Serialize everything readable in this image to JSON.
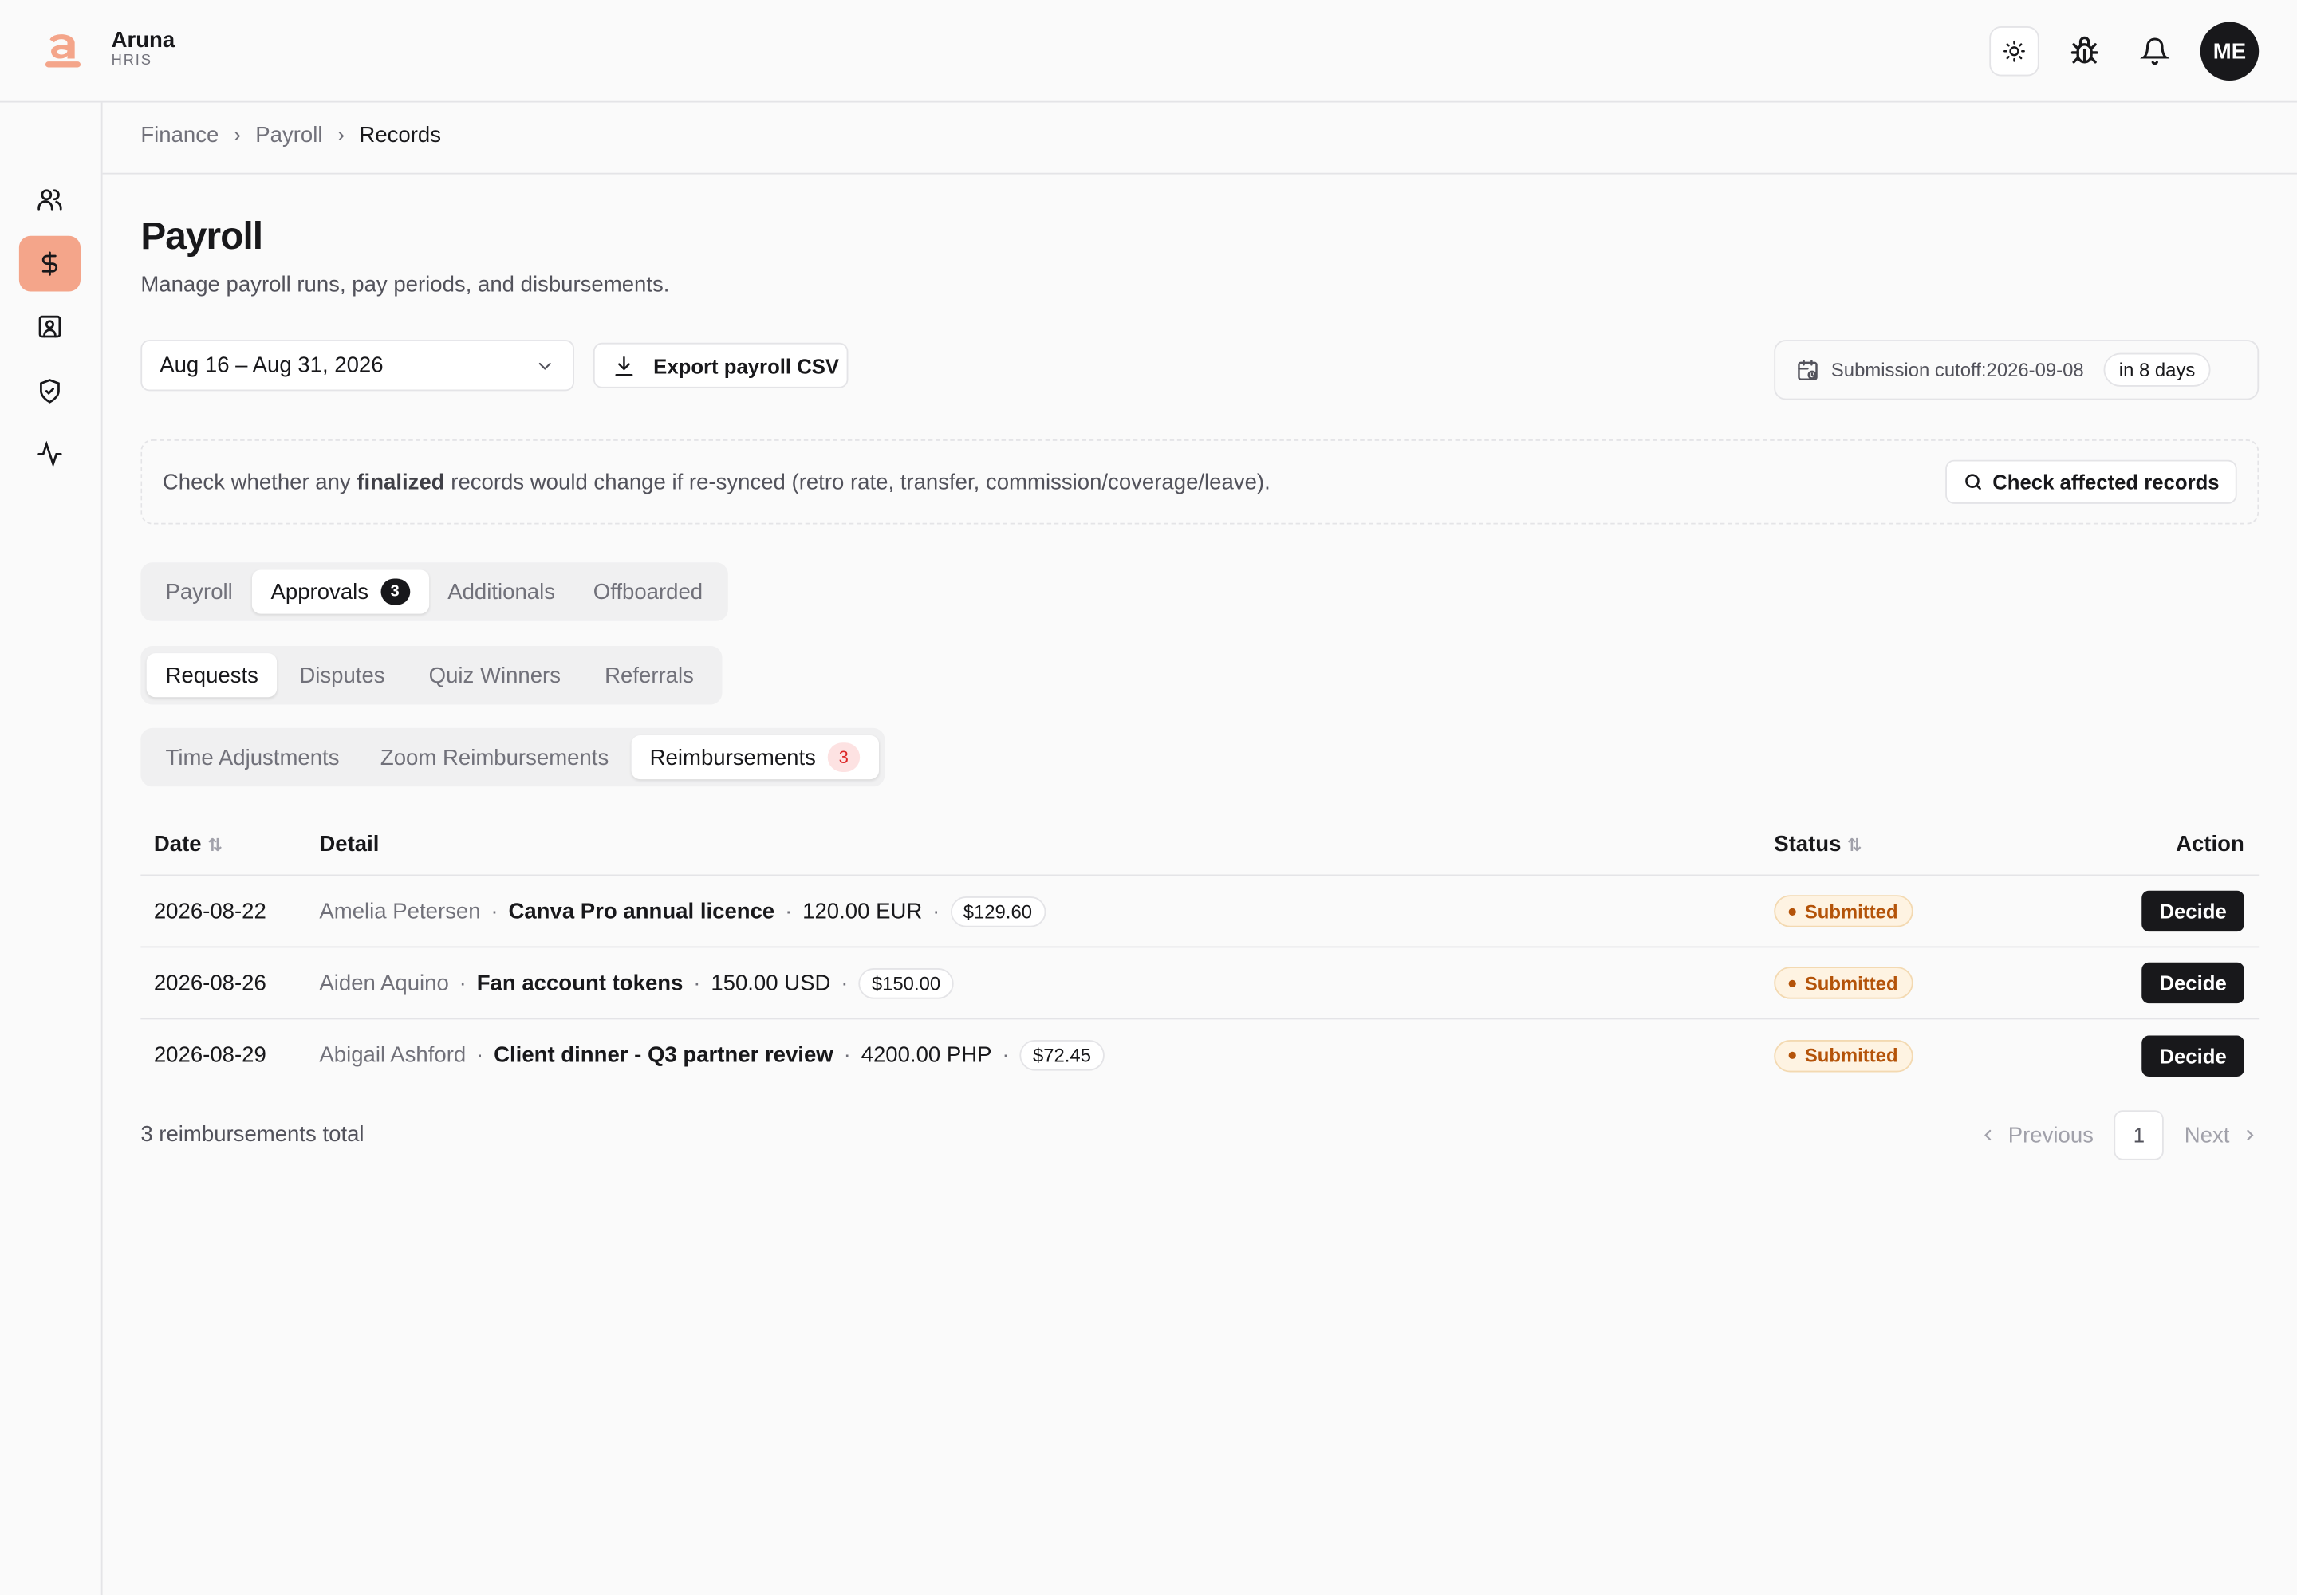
{
  "brand": {
    "name": "Aruna",
    "sub": "HRIS"
  },
  "user": {
    "initials": "ME"
  },
  "breadcrumb": [
    "Finance",
    "Payroll",
    "Records"
  ],
  "page": {
    "title": "Payroll",
    "subtitle": "Manage payroll runs, pay periods, and disbursements."
  },
  "controls": {
    "period": "Aug 16 – Aug 31, 2026",
    "export_label": "Export payroll CSV",
    "cutoff_label": "Submission cutoff:",
    "cutoff_date": "2026-09-08",
    "cutoff_remaining": "in 8 days"
  },
  "banner": {
    "text_before": "Check whether any ",
    "text_bold": "finalized",
    "text_after": " records would change if re-synced (retro rate, transfer, commission/coverage/leave).",
    "button_label": "Check affected records"
  },
  "main_tabs": [
    {
      "label": "Payroll"
    },
    {
      "label": "Approvals",
      "count": "3"
    },
    {
      "label": "Additionals"
    },
    {
      "label": "Offboarded"
    }
  ],
  "sub_tabs": [
    {
      "label": "Requests"
    },
    {
      "label": "Disputes"
    },
    {
      "label": "Quiz Winners"
    },
    {
      "label": "Referrals"
    }
  ],
  "type_tabs": [
    {
      "label": "Time Adjustments"
    },
    {
      "label": "Zoom Reimbursements"
    },
    {
      "label": "Reimbursements",
      "count": "3"
    }
  ],
  "table": {
    "headers": {
      "date": "Date",
      "detail": "Detail",
      "status": "Status",
      "action": "Action"
    },
    "rows": [
      {
        "date": "2026-08-22",
        "name": "Amelia Petersen",
        "title": "Canva Pro annual licence",
        "amount": "120.00 EUR",
        "converted": "$129.60",
        "status": "Submitted",
        "action": "Decide"
      },
      {
        "date": "2026-08-26",
        "name": "Aiden Aquino",
        "title": "Fan account tokens",
        "amount": "150.00 USD",
        "converted": "$150.00",
        "status": "Submitted",
        "action": "Decide"
      },
      {
        "date": "2026-08-29",
        "name": "Abigail Ashford",
        "title": "Client dinner - Q3 partner review",
        "amount": "4200.00 PHP",
        "converted": "$72.45",
        "status": "Submitted",
        "action": "Decide"
      }
    ]
  },
  "footer": {
    "total": "3 reimbursements total",
    "previous": "Previous",
    "page": "1",
    "next": "Next"
  },
  "colors": {
    "accent": "#f4a58a",
    "status_text": "#b45309",
    "dark": "#18181b"
  }
}
